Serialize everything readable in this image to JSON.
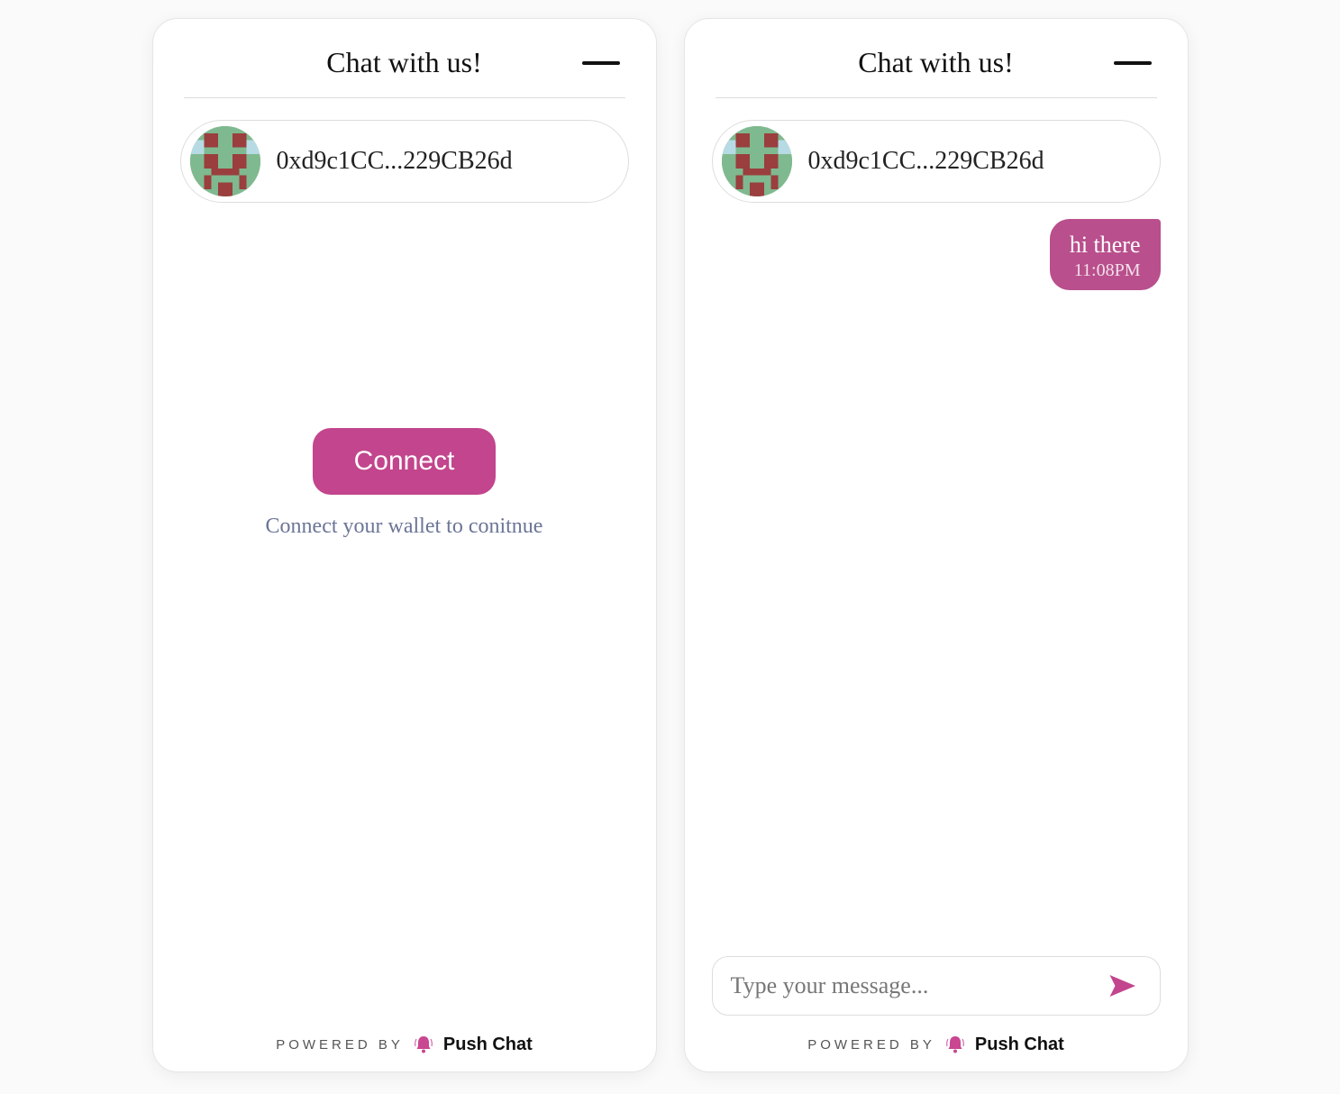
{
  "header": {
    "title": "Chat with us!"
  },
  "address": {
    "display": "0xd9c1CC...229CB26d"
  },
  "left": {
    "connect_label": "Connect",
    "connect_hint": "Connect your wallet to conitnue"
  },
  "right": {
    "messages": [
      {
        "text": "hi there",
        "time": "11:08PM"
      }
    ],
    "input_placeholder": "Type your message..."
  },
  "footer": {
    "powered_by": "POWERED BY",
    "brand": "Push Chat"
  }
}
